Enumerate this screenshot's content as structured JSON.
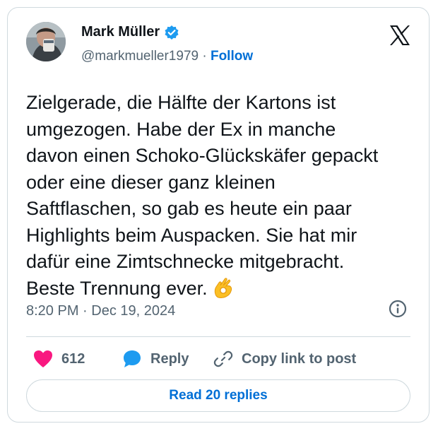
{
  "author": {
    "name": "Mark Müller",
    "handle": "@markmueller1979",
    "separator": "·",
    "follow_label": "Follow"
  },
  "tweet": {
    "text": "Zielgerade, die Hälfte der Kartons ist\numgezogen. Habe der Ex in manche\ndavon einen Schoko-Glückskäfer gepackt\noder eine dieser ganz kleinen\nSaftflaschen, so gab es heute ein paar\nHighlights beim Auspacken. Sie hat mir\ndafür eine Zimtschnecke mitgebracht.\nBeste Trennung ever.",
    "emoji": "ok-hand-emoji",
    "time": "8:20 PM",
    "date_separator": "·",
    "date": "Dec 19, 2024"
  },
  "actions": {
    "like_count": "612",
    "reply_label": "Reply",
    "copy_link_label": "Copy link to post"
  },
  "footer": {
    "read_replies_label": "Read 20 replies"
  },
  "icons": {
    "brand": "x-logo-icon",
    "verified": "verified-badge-icon",
    "info": "info-icon",
    "like": "heart-icon",
    "reply": "speech-bubble-icon",
    "copy": "link-icon"
  },
  "colors": {
    "text": "#0f1419",
    "secondary": "#536471",
    "link": "#006fd6",
    "verified": "#1d9bf0",
    "like": "#f91880",
    "border": "#cfd9de"
  }
}
